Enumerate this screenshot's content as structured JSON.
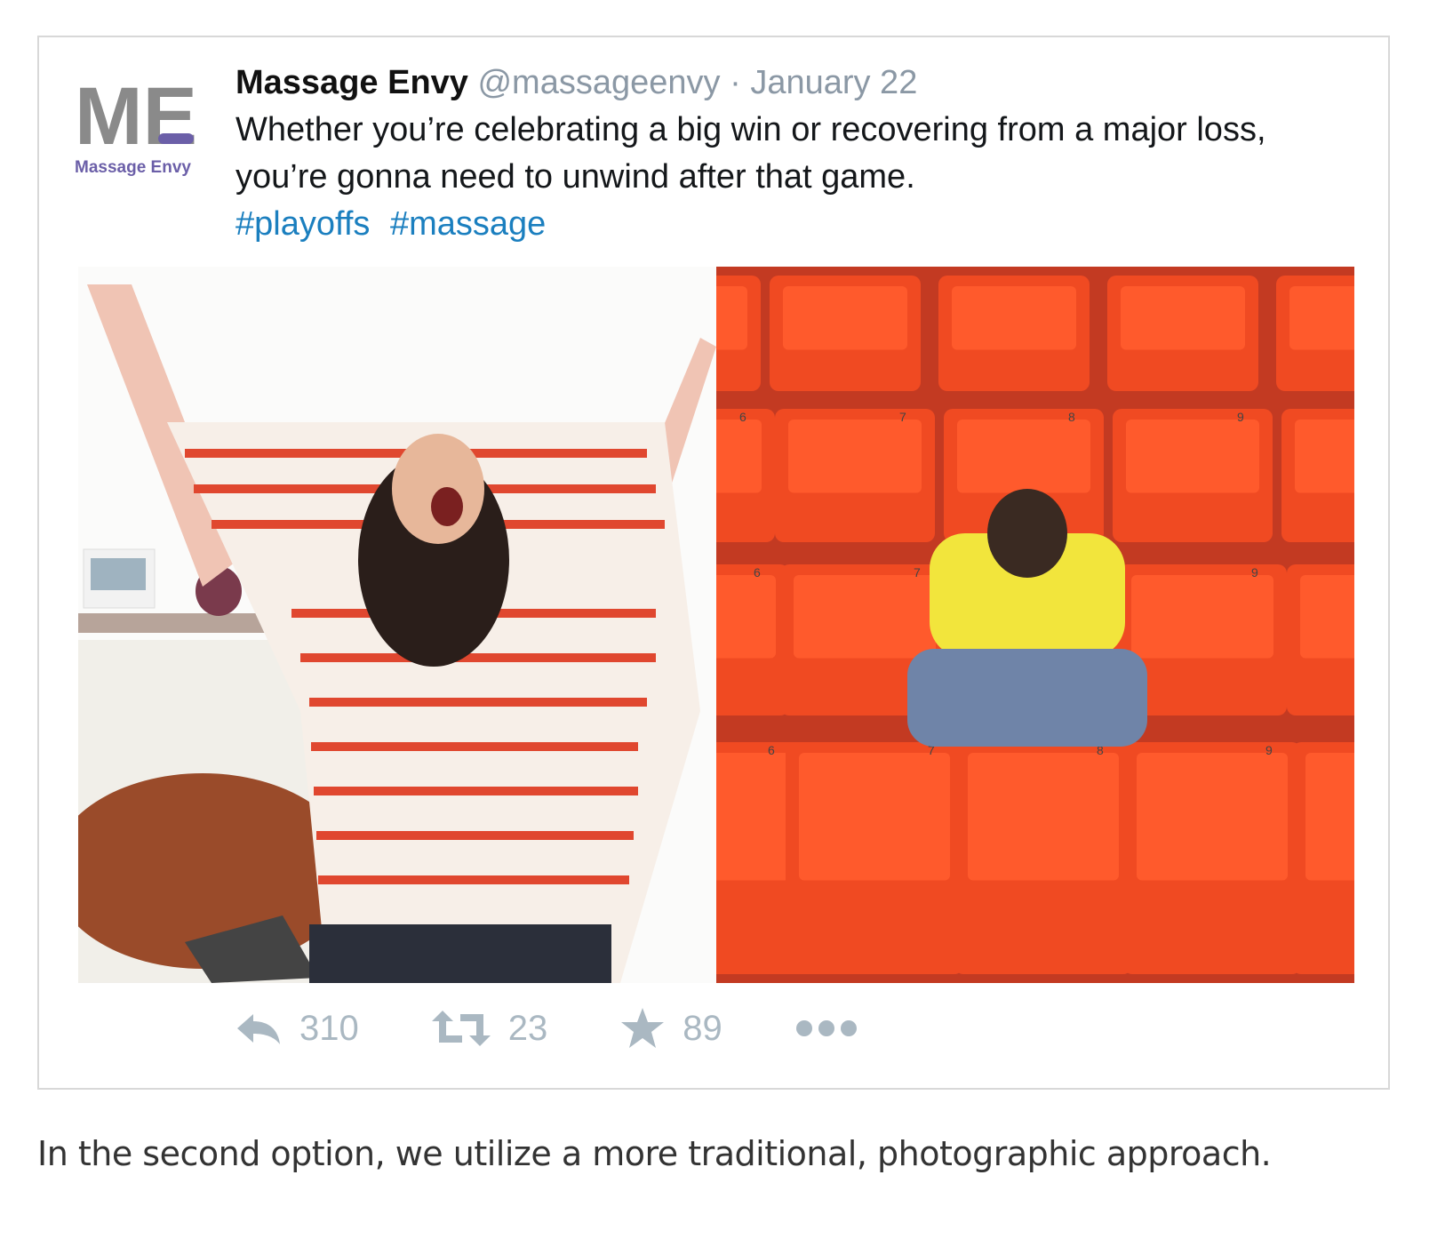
{
  "tweet": {
    "avatar": {
      "logo_letters": "ME",
      "brand_name": "Massage Envy",
      "icon": "massage-envy-logo"
    },
    "author": "Massage Envy",
    "handle": "@massageenvy",
    "separator": "·",
    "date": "January 22",
    "text": "Whether you’re celebrating a big win or recovering from a major loss, you’re gonna need to unwind after that game.",
    "hashtags": [
      "#playoffs",
      "#massage"
    ],
    "images": [
      {
        "id": "celebrating-woman-photo"
      },
      {
        "id": "disappointed-fan-stadium-photo"
      }
    ],
    "seat_numbers": [
      "6",
      "7",
      "8",
      "9"
    ],
    "actions": {
      "reply": {
        "icon": "reply-icon",
        "count": "310"
      },
      "retweet": {
        "icon": "retweet-icon",
        "count": "23"
      },
      "favorite": {
        "icon": "star-icon",
        "count": "89"
      },
      "more": {
        "icon": "more-dots-icon"
      }
    }
  },
  "caption": "In the second option, we utilize a more traditional, photographic approach.",
  "colors": {
    "hashtag": "#1b7fbf",
    "muted": "#8b98a5",
    "action": "#aab8c2",
    "logo_gray": "#8a8a8a",
    "logo_purple": "#6b5fa8",
    "seat_orange": "#f04a22"
  }
}
